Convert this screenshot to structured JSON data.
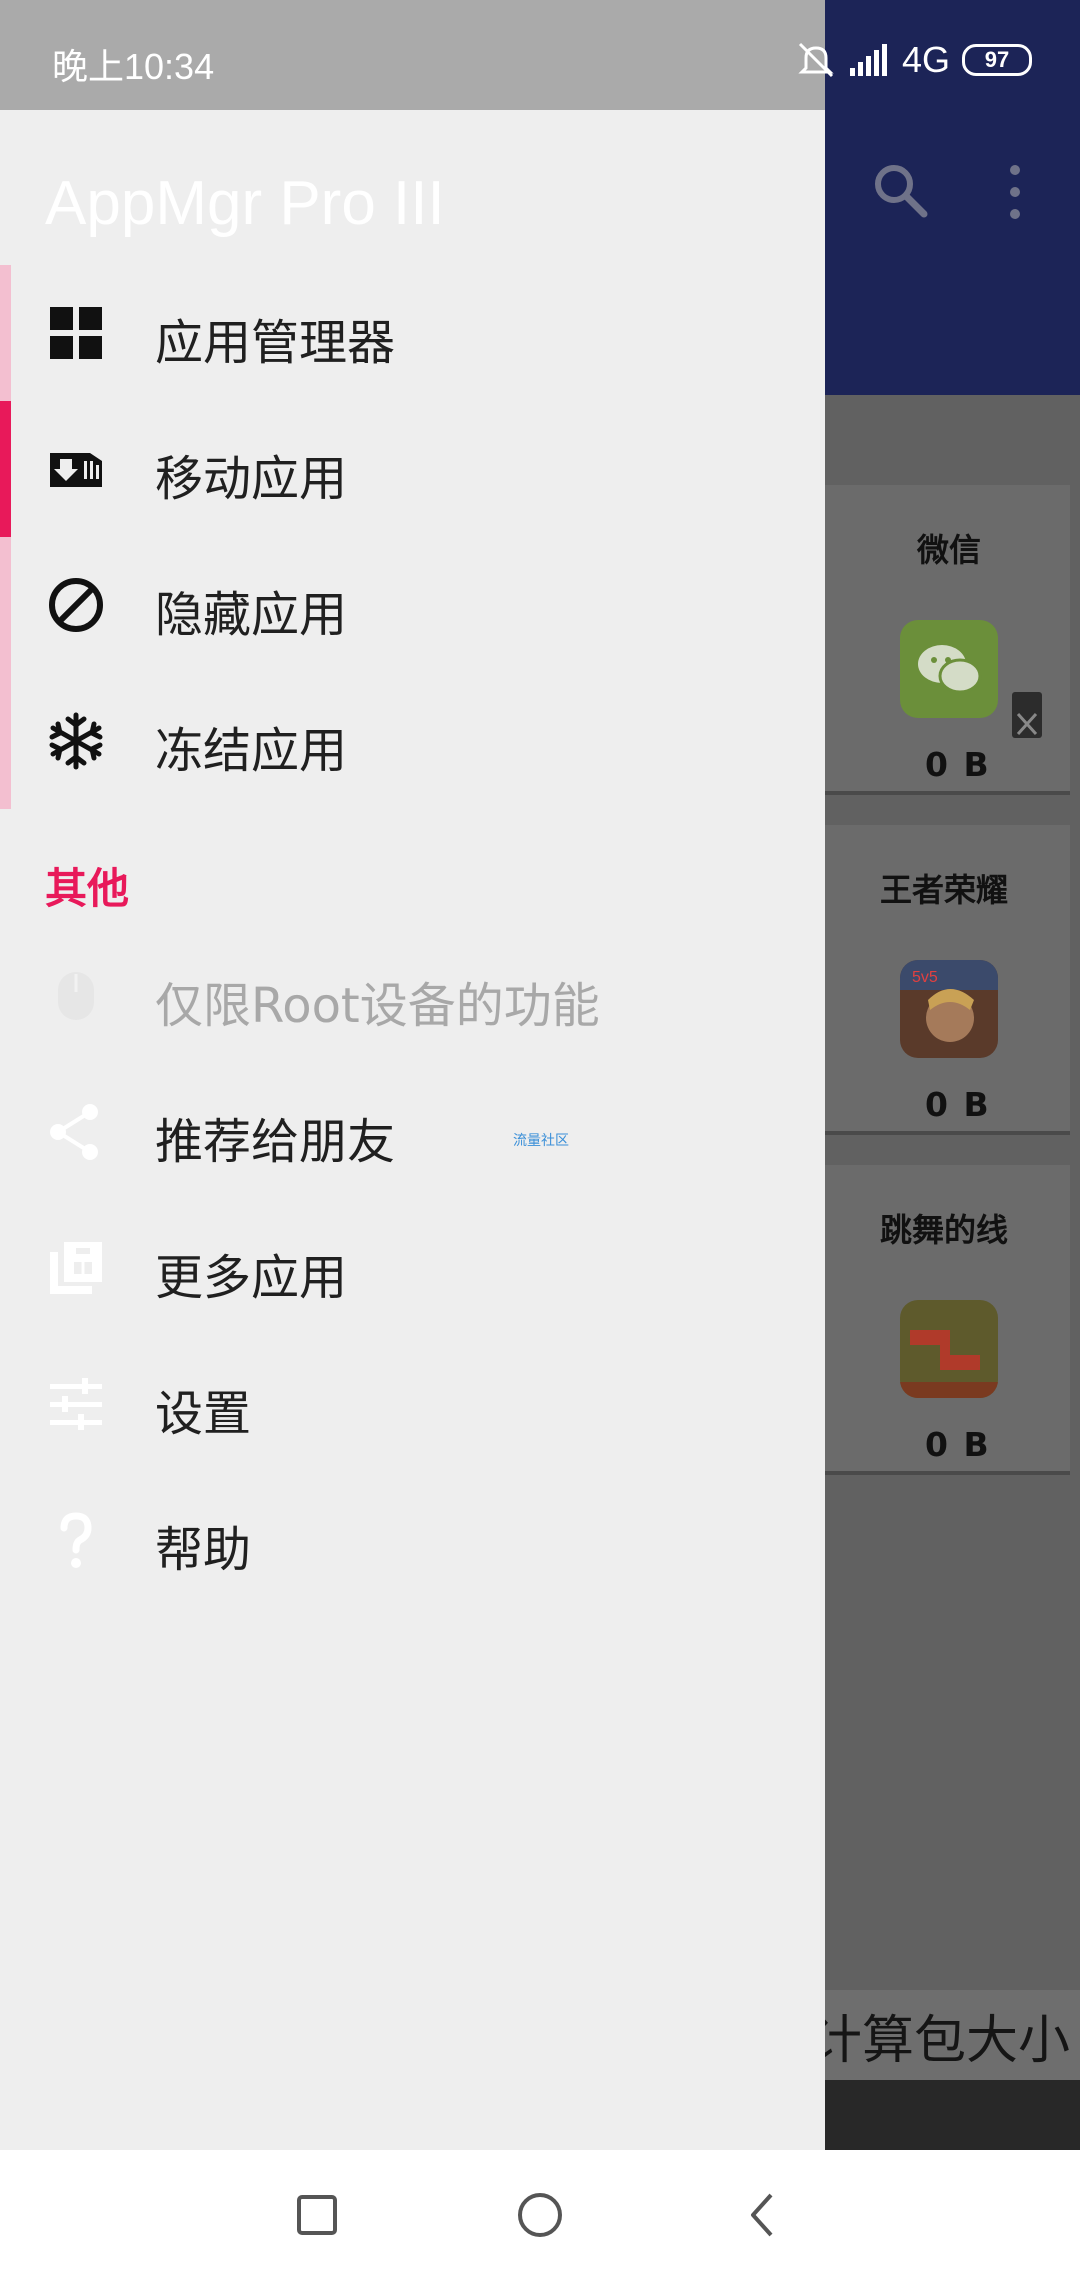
{
  "status_bar": {
    "time": "晚上10:34",
    "network": "4G",
    "battery": "97"
  },
  "drawer": {
    "title": "AppMgr Pro III",
    "primary_items": [
      {
        "label": "应用管理器",
        "icon": "grid-icon"
      },
      {
        "label": "移动应用",
        "icon": "sd-move-icon",
        "active": true
      },
      {
        "label": "隐藏应用",
        "icon": "block-icon"
      },
      {
        "label": "冻结应用",
        "icon": "snowflake-icon"
      }
    ],
    "section_header": "其他",
    "other_items": [
      {
        "label": "仅限Root设备的功能",
        "icon": "root-icon",
        "disabled": true
      },
      {
        "label": "推荐给朋友",
        "icon": "share-icon"
      },
      {
        "label": "更多应用",
        "icon": "store-icon"
      },
      {
        "label": "设置",
        "icon": "sliders-icon"
      },
      {
        "label": "帮助",
        "icon": "help-icon"
      }
    ]
  },
  "watermark": "流量社区",
  "background_app": {
    "cards": [
      {
        "name": "微信",
        "size": "0 B"
      },
      {
        "name": "王者荣耀",
        "size": "0 B"
      },
      {
        "name": "跳舞的线",
        "size": "0 B"
      }
    ],
    "bottom_label": "计算包大小"
  },
  "colors": {
    "accent": "#e8195a",
    "toolbar": "#1c2457",
    "drawer_bg": "#eeeeee"
  }
}
